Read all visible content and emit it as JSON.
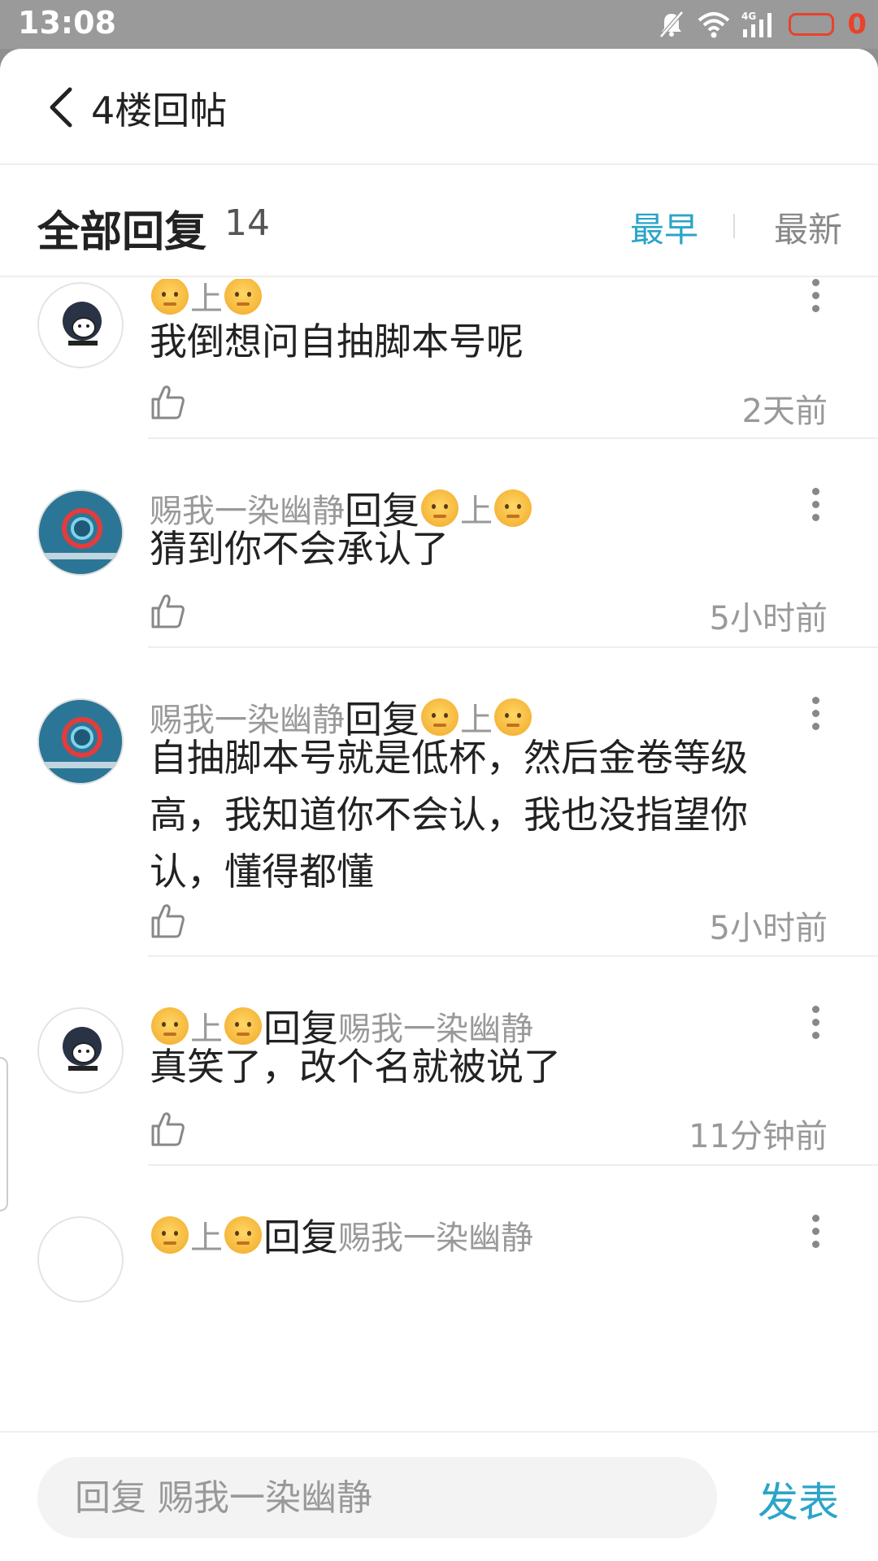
{
  "status_bar": {
    "time": "13:08",
    "battery_level": "0"
  },
  "header": {
    "title": "4楼回帖"
  },
  "filter": {
    "title": "全部回复",
    "count": "14",
    "sort_earliest": "最早",
    "sort_latest": "最新"
  },
  "replies": [
    {
      "author": "上",
      "reply_word": "",
      "target": "",
      "content": "我倒想问自抽脚本号呢",
      "time": "2天前"
    },
    {
      "author": "赐我一染幽静",
      "reply_word": "回复",
      "target": "上",
      "content": "猜到你不会承认了",
      "time": "5小时前"
    },
    {
      "author": "赐我一染幽静",
      "reply_word": "回复",
      "target": "上",
      "content": "自抽脚本号就是低杯，然后金卷等级高，我知道你不会认，我也没指望你认，懂得都懂",
      "time": "5小时前"
    },
    {
      "author": "上",
      "reply_word": "回复",
      "target": "赐我一染幽静",
      "content": "真笑了，改个名就被说了",
      "time": "11分钟前"
    },
    {
      "author": "上",
      "reply_word": "回复",
      "target": "赐我一染幽静",
      "content": "",
      "time": ""
    }
  ],
  "footer": {
    "input_placeholder": "回复 赐我一染幽静",
    "publish_label": "发表"
  },
  "colors": {
    "accent": "#2ba4c9",
    "battery": "#e8432a"
  }
}
